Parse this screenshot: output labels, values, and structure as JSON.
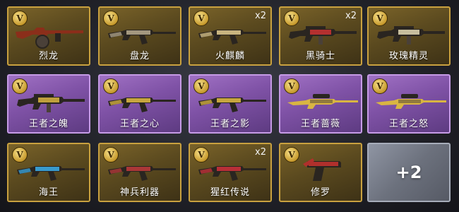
{
  "badge_letter": "V",
  "rows": [
    [
      {
        "name": "烈龙",
        "count": "",
        "tier": "gold",
        "weapon": "tommy",
        "accent": "#8b2e1a"
      },
      {
        "name": "盘龙",
        "count": "",
        "tier": "gold",
        "weapon": "ak",
        "accent": "#b0a48a"
      },
      {
        "name": "火麒麟",
        "count": "x2",
        "tier": "gold",
        "weapon": "ak",
        "accent": "#d9c48a"
      },
      {
        "name": "黑骑士",
        "count": "x2",
        "tier": "gold",
        "weapon": "m4",
        "accent": "#c33"
      },
      {
        "name": "玫瑰精灵",
        "count": "",
        "tier": "gold",
        "weapon": "m4",
        "accent": "#e3d9b5"
      }
    ],
    [
      {
        "name": "王者之魄",
        "count": "",
        "tier": "purple",
        "weapon": "m4",
        "accent": "#d9b542"
      },
      {
        "name": "王者之心",
        "count": "",
        "tier": "purple",
        "weapon": "ak",
        "accent": "#d9b542"
      },
      {
        "name": "王者之影",
        "count": "",
        "tier": "purple",
        "weapon": "ak",
        "accent": "#d9b542"
      },
      {
        "name": "王者蔷薇",
        "count": "",
        "tier": "purple",
        "weapon": "sniper",
        "accent": "#d9b542"
      },
      {
        "name": "王者之怒",
        "count": "",
        "tier": "purple",
        "weapon": "sniper",
        "accent": "#d9b542"
      }
    ],
    [
      {
        "name": "海王",
        "count": "",
        "tier": "gold",
        "weapon": "ak",
        "accent": "#3aa7e0"
      },
      {
        "name": "神兵利器",
        "count": "",
        "tier": "gold",
        "weapon": "ak",
        "accent": "#b83a3a"
      },
      {
        "name": "猩红传说",
        "count": "x2",
        "tier": "gold",
        "weapon": "ak",
        "accent": "#c8313a"
      },
      {
        "name": "修罗",
        "count": "",
        "tier": "gold",
        "weapon": "pistol",
        "accent": "#b0302c"
      },
      {
        "name": "",
        "count": "",
        "tier": "more",
        "more_label": "+2"
      }
    ]
  ]
}
